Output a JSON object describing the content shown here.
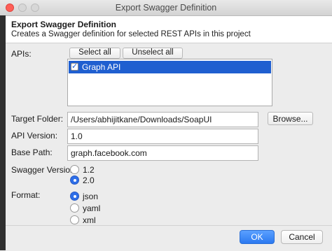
{
  "window": {
    "title": "Export Swagger Definition"
  },
  "header": {
    "title": "Export Swagger Definition",
    "description": "Creates a Swagger definition for selected REST APIs in this project"
  },
  "apis": {
    "label": "APIs:",
    "select_all": "Select all",
    "unselect_all": "Unselect all",
    "items": [
      {
        "label": "Graph API",
        "checked": true,
        "selected": true
      }
    ]
  },
  "target_folder": {
    "label": "Target Folder:",
    "value": "/Users/abhijitkane/Downloads/SoapUI",
    "browse": "Browse..."
  },
  "api_version": {
    "label": "API Version:",
    "value": "1.0"
  },
  "base_path": {
    "label": "Base Path:",
    "value": "graph.facebook.com"
  },
  "swagger_version": {
    "label": "Swagger Version:",
    "options": [
      {
        "label": "1.2",
        "selected": false
      },
      {
        "label": "2.0",
        "selected": true
      }
    ]
  },
  "format": {
    "label": "Format:",
    "options": [
      {
        "label": "json",
        "selected": true
      },
      {
        "label": "yaml",
        "selected": false
      },
      {
        "label": "xml",
        "selected": false
      }
    ]
  },
  "footer": {
    "ok": "OK",
    "cancel": "Cancel"
  },
  "colors": {
    "accent": "#1f5fd0",
    "ok_button": "#2b79f0",
    "close_light": "#fe5f57"
  }
}
